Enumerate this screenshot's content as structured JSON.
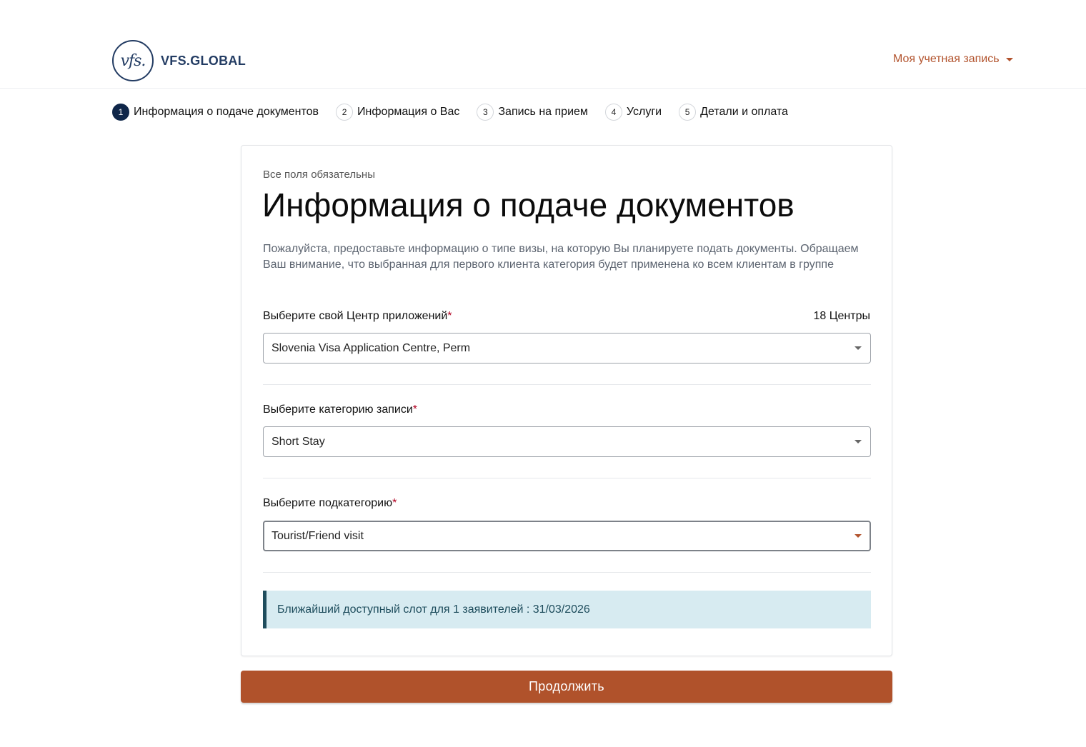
{
  "header": {
    "logo_mark": "vfs.",
    "logo_text": "VFS.GLOBAL",
    "account_label": "Моя учетная запись"
  },
  "stepper": {
    "steps": [
      {
        "num": "1",
        "label": "Информация о подаче документов"
      },
      {
        "num": "2",
        "label": "Информация о Вас"
      },
      {
        "num": "3",
        "label": "Запись на прием"
      },
      {
        "num": "4",
        "label": "Услуги"
      },
      {
        "num": "5",
        "label": "Детали и оплата"
      }
    ]
  },
  "form": {
    "required_note": "Все поля обязательны",
    "title": "Информация о подаче документов",
    "intro": "Пожалуйста, предоставьте информацию о типе визы, на которую Вы планируете подать документы. Обращаем Ваш внимание, что выбранная для первого клиента категория будет применена ко всем клиентам в группе",
    "centre": {
      "label": "Выберите свой Центр приложений",
      "count": "18 Центры",
      "value": "Slovenia Visa Application Centre, Perm"
    },
    "category": {
      "label": "Выберите категорию записи",
      "value": "Short Stay"
    },
    "subcategory": {
      "label": "Выберите подкатегорию",
      "value": "Tourist/Friend visit"
    },
    "asterisk": "*",
    "slot_message": "Ближайший доступный слот для 1 заявителей : 31/03/2026"
  },
  "actions": {
    "continue_label": "Продолжить"
  },
  "colors": {
    "brand_navy": "#233c63",
    "accent_rust": "#b0522b",
    "alert_bg": "#d7ebf1"
  }
}
